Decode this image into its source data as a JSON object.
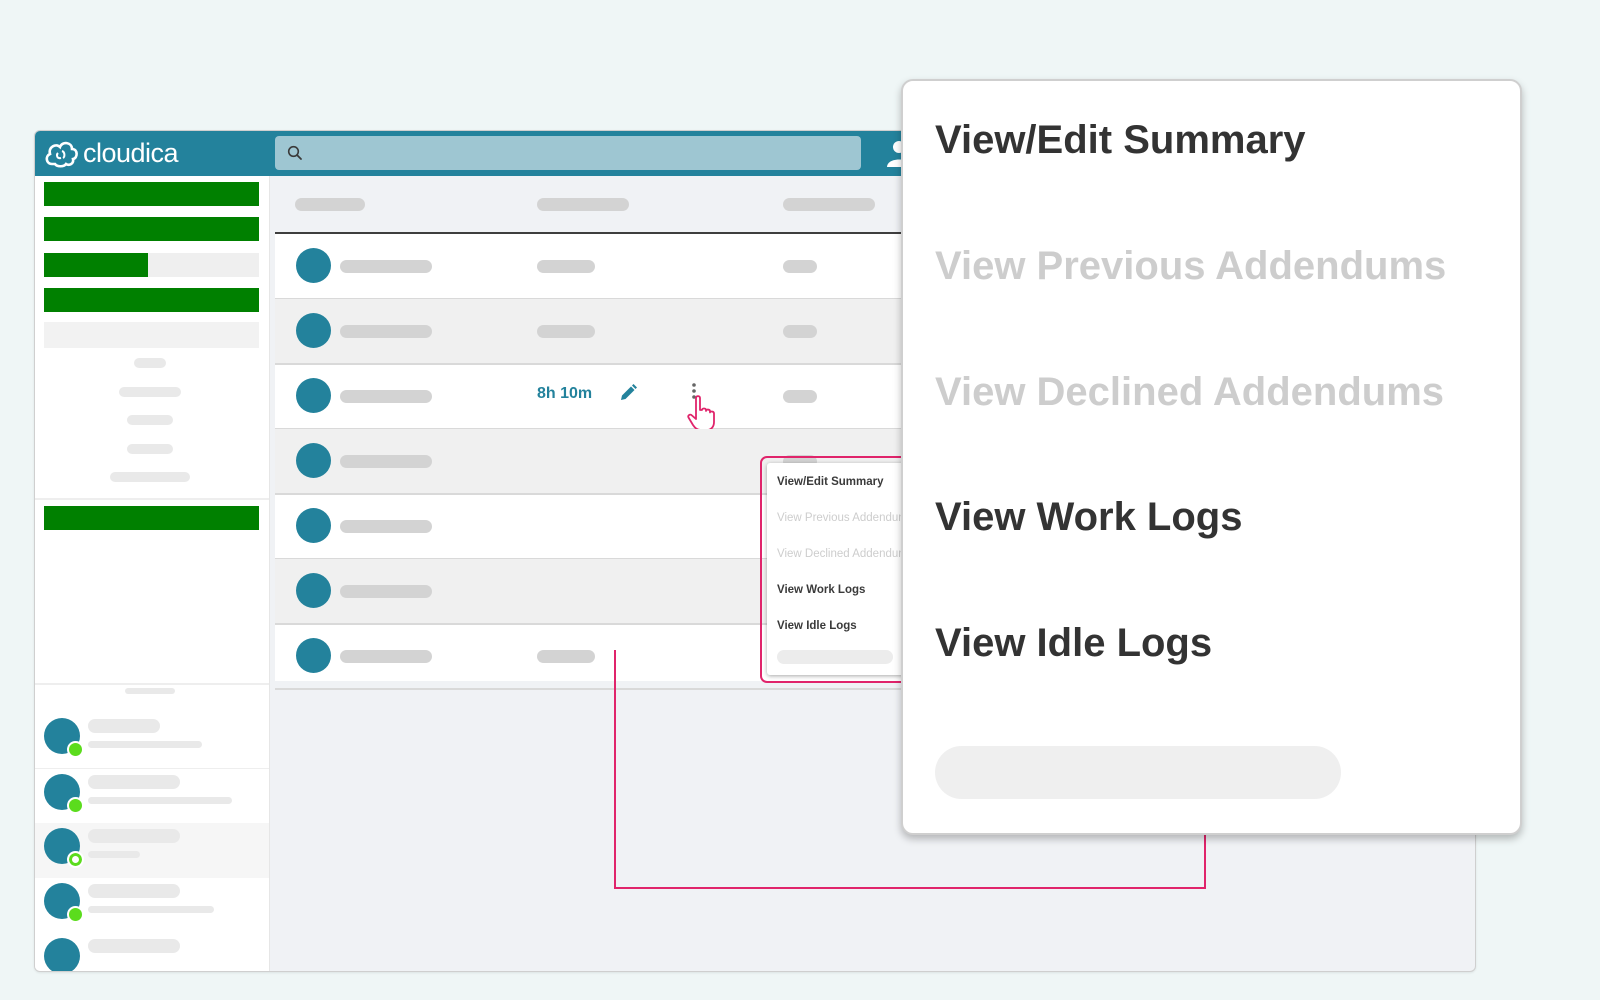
{
  "app": {
    "logo_text": "cloudica"
  },
  "table": {
    "active_row_time": "8h 10m"
  },
  "menu": {
    "items": [
      {
        "label": "View/Edit Summary",
        "enabled": true
      },
      {
        "label": "View Previous Addendums",
        "enabled": false
      },
      {
        "label": "View Declined Addendums",
        "enabled": false
      },
      {
        "label": "View Work Logs",
        "enabled": true
      },
      {
        "label": "View Idle Logs",
        "enabled": true
      }
    ]
  },
  "colors": {
    "brand": "#23829c",
    "highlight": "#e0246b",
    "sidebar_bar": "#008000",
    "status_online": "#5bdc1d"
  },
  "icons": [
    "cloud-logo-icon",
    "search-icon",
    "user-icon",
    "edit-icon",
    "kebab-menu-icon",
    "pointer-hand-icon",
    "status-dot-icon"
  ]
}
